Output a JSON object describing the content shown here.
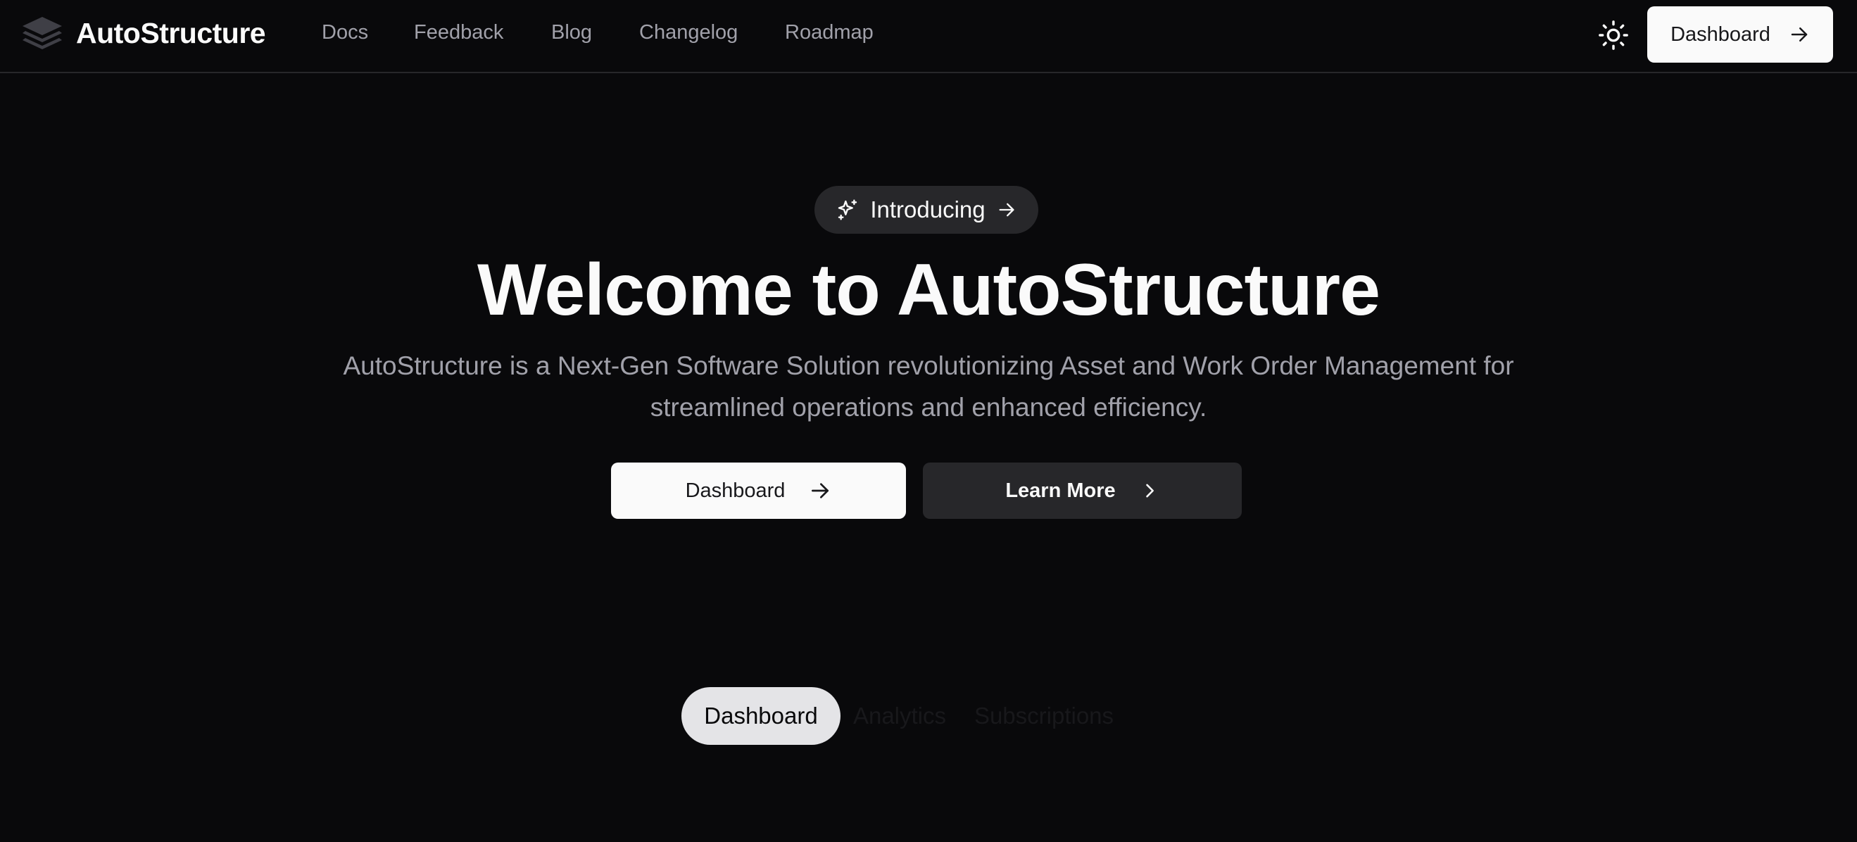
{
  "brand": {
    "name": "AutoStructure"
  },
  "nav": {
    "links": [
      {
        "label": "Docs"
      },
      {
        "label": "Feedback"
      },
      {
        "label": "Blog"
      },
      {
        "label": "Changelog"
      },
      {
        "label": "Roadmap"
      }
    ],
    "theme_icon": "sun-icon",
    "cta_label": "Dashboard"
  },
  "hero": {
    "badge_label": "Introducing",
    "title": "Welcome to AutoStructure",
    "subtitle": "AutoStructure is a Next-Gen Software Solution revolutionizing Asset and Work Order Management for streamlined operations and enhanced efficiency.",
    "primary_label": "Dashboard",
    "secondary_label": "Learn More"
  },
  "tabs": [
    {
      "label": "Dashboard",
      "active": true
    },
    {
      "label": "Analytics",
      "active": false
    },
    {
      "label": "Subscriptions",
      "active": false
    }
  ],
  "colors": {
    "background": "#09090b",
    "foreground": "#fafafa",
    "muted": "#a1a1aa",
    "secondary": "#27272a"
  }
}
